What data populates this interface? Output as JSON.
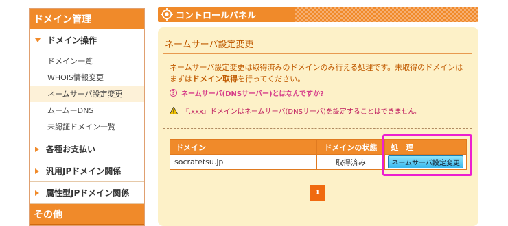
{
  "sidebar": {
    "domain_header": "ドメイン管理",
    "domain_ops": "ドメイン操作",
    "items": [
      {
        "label": "ドメイン一覧"
      },
      {
        "label": "WHOIS情報変更"
      },
      {
        "label": "ネームサーバ設定変更"
      },
      {
        "label": "ムームーDNS"
      },
      {
        "label": "未認証ドメイン一覧"
      }
    ],
    "categories": [
      {
        "label": "各種お支払い"
      },
      {
        "label": "汎用JPドメイン関係"
      },
      {
        "label": "属性型JPドメイン関係"
      }
    ],
    "other_header": "その他"
  },
  "header": {
    "title": "コントロールパネル"
  },
  "panel": {
    "title": "ネームサーバ設定変更",
    "desc_line1": "ネームサーバ設定変更は取得済みのドメインのみ行える処理です。未取得のドメインは",
    "desc_line2_pre": "まずは",
    "desc_line2_link": "ドメイン取得",
    "desc_line2_post": "を行ってください。",
    "help_text": "ネームサーバ(DNSサーバー)とはなんですか?",
    "warn_text": "『.xxx』ドメインはネームサーバ(DNSサーバ)を設定することはできません。"
  },
  "table": {
    "headers": [
      "ドメイン",
      "ドメインの状態",
      "処　理"
    ],
    "rows": [
      {
        "domain": "socratetsu.jp",
        "status": "取得済み",
        "action": "ネームサーバ設定変更"
      }
    ]
  },
  "pager": {
    "current": "1"
  },
  "colors": {
    "accent": "#f08a2a",
    "panel": "#fdf1c8",
    "highlight": "#ec1fd0",
    "button": "#39b8ee"
  },
  "icons": [
    "gear-icon",
    "triangle-down-icon",
    "triangle-right-icon",
    "help-icon",
    "warning-icon"
  ]
}
